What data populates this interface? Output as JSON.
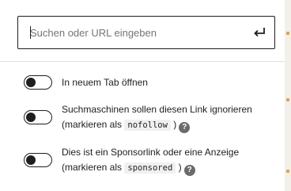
{
  "search": {
    "placeholder": "Suchen oder URL eingeben",
    "submit_icon": "enter-return-icon"
  },
  "settings": [
    {
      "label": "In neuem Tab öffnen",
      "enabled": false
    },
    {
      "line1": "Suchmaschinen sollen diesen Link ignorieren",
      "pre": "(markieren als",
      "code": "nofollow",
      "post": ")",
      "help_icon": "?",
      "enabled": false
    },
    {
      "line1": "Dies ist ein Sponsorlink oder eine Anzeige",
      "pre": "(markieren als",
      "code": "sponsored",
      "post": ")",
      "help_icon": "?",
      "enabled": false
    }
  ],
  "colors": {
    "text": "#1e1e1e",
    "border": "#1e1e1e",
    "divider": "#e0e0e0",
    "help": "#6b6b6b"
  }
}
